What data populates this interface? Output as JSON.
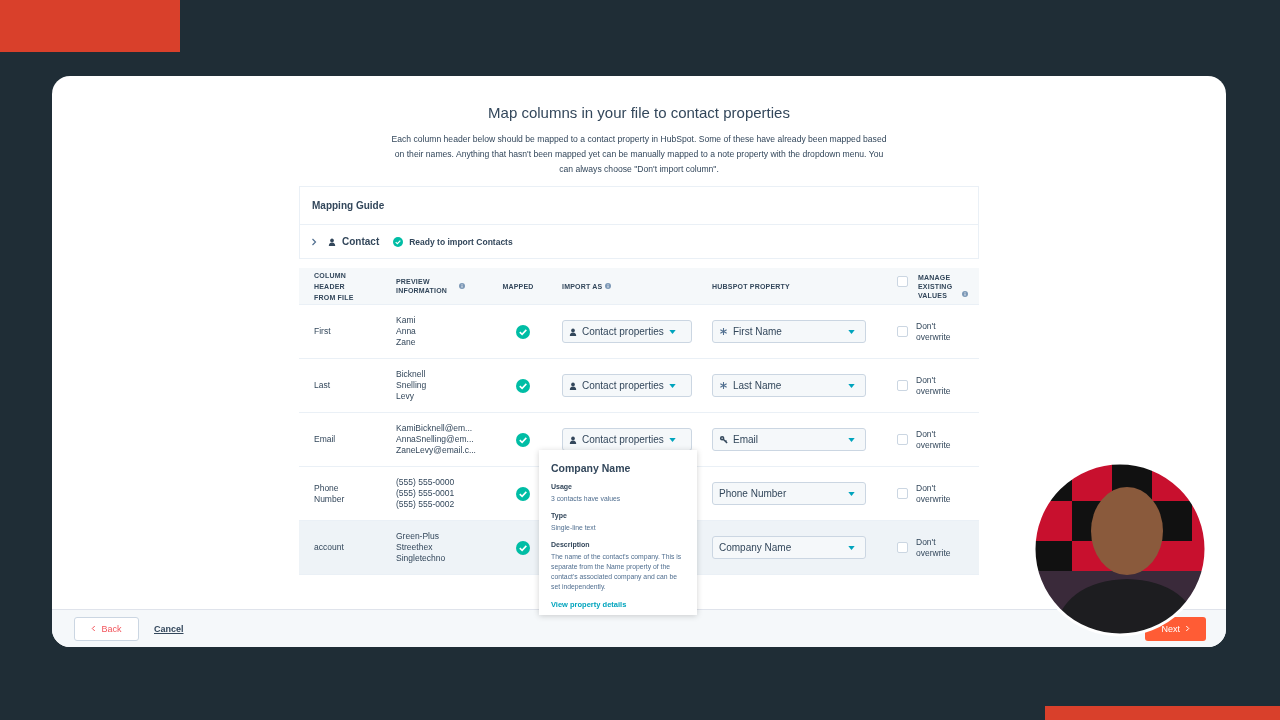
{
  "page": {
    "title": "Map columns in your file to contact properties",
    "description": "Each column header below should be mapped to a contact property in HubSpot. Some of these have already been mapped based on their names. Anything that hasn't been mapped yet can be manually mapped to a note property with the dropdown menu. You can always choose \"Don't import column\"."
  },
  "guide": {
    "title": "Mapping Guide",
    "object": "Contact",
    "expanded": false,
    "status": "Ready to import Contacts"
  },
  "table": {
    "columns": [
      {
        "label": "COLUMN HEADER FROM FILE",
        "info": false
      },
      {
        "label": "PREVIEW INFORMATION",
        "info": true
      },
      {
        "label": "MAPPED",
        "info": false
      },
      {
        "label": "IMPORT AS",
        "info": true
      },
      {
        "label": "HUBSPOT PROPERTY",
        "info": false
      },
      {
        "label": "MANAGE EXISTING VALUES",
        "info": true
      }
    ],
    "manage_all_checked": false,
    "rows": [
      {
        "column": "First",
        "preview": [
          "Kami",
          "Anna",
          "Zane"
        ],
        "mapped": true,
        "import_as": "Contact properties",
        "property": "First Name",
        "kind": "required",
        "overwrite": "Don't overwrite",
        "checked": false,
        "hovered": false
      },
      {
        "column": "Last",
        "preview": [
          "Bicknell",
          "Snelling",
          "Levy"
        ],
        "mapped": true,
        "import_as": "Contact properties",
        "property": "Last Name",
        "kind": "required",
        "overwrite": "Don't overwrite",
        "checked": false,
        "hovered": false
      },
      {
        "column": "Email",
        "preview": [
          "KamiBicknell@em...",
          "AnnaSnelling@em...",
          "ZaneLevy@email.c..."
        ],
        "mapped": true,
        "import_as": "Contact properties",
        "property": "Email",
        "kind": "key",
        "overwrite": "Don't overwrite",
        "checked": false,
        "hovered": false
      },
      {
        "column": "Phone Number",
        "preview": [
          "(555) 555-0000",
          "(555) 555-0001",
          "(555) 555-0002"
        ],
        "mapped": true,
        "property": "Phone Number",
        "kind": "plain",
        "overwrite": "Don't overwrite",
        "checked": false,
        "hovered": false
      },
      {
        "column": "account",
        "preview": [
          "Green-Plus",
          "Streethex",
          "Singletechno"
        ],
        "mapped": true,
        "property": "Company Name",
        "kind": "plain",
        "overwrite": "Don't overwrite",
        "checked": false,
        "hovered": true
      }
    ]
  },
  "popover": {
    "title": "Company Name",
    "sections": [
      {
        "label": "Usage",
        "text": "3 contacts have values"
      },
      {
        "label": "Type",
        "text": "Single-line text"
      },
      {
        "label": "Description",
        "text": "The name of the contact's company. This is separate from the Name property of the contact's associated company and can be set independently."
      }
    ],
    "link": "View property details"
  },
  "footer": {
    "back": "Back",
    "cancel": "Cancel",
    "next": "Next"
  }
}
